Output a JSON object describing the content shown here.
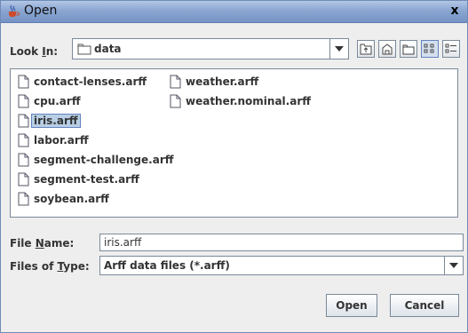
{
  "window": {
    "title": "Open",
    "close_symbol": "x"
  },
  "look_in": {
    "label_before": "Look ",
    "label_mnemonic": "I",
    "label_after": "n:",
    "value": "data"
  },
  "files": [
    {
      "name": "contact-lenses.arff"
    },
    {
      "name": "cpu.arff"
    },
    {
      "name": "iris.arff",
      "selected": true
    },
    {
      "name": "labor.arff"
    },
    {
      "name": "segment-challenge.arff"
    },
    {
      "name": "segment-test.arff"
    },
    {
      "name": "soybean.arff"
    },
    {
      "name": "weather.arff"
    },
    {
      "name": "weather.nominal.arff"
    }
  ],
  "file_name": {
    "label_before": "File ",
    "label_mnemonic": "N",
    "label_after": "ame:",
    "value": "iris.arff"
  },
  "file_type": {
    "label_before": "Files of ",
    "label_mnemonic": "T",
    "label_after": "ype:",
    "value": "Arff data files (*.arff)"
  },
  "buttons": {
    "open": "Open",
    "cancel": "Cancel"
  },
  "colors": {
    "title_gradient": "#8aa6d1",
    "selection": "#b8cfe5",
    "border": "#7a8a99"
  }
}
